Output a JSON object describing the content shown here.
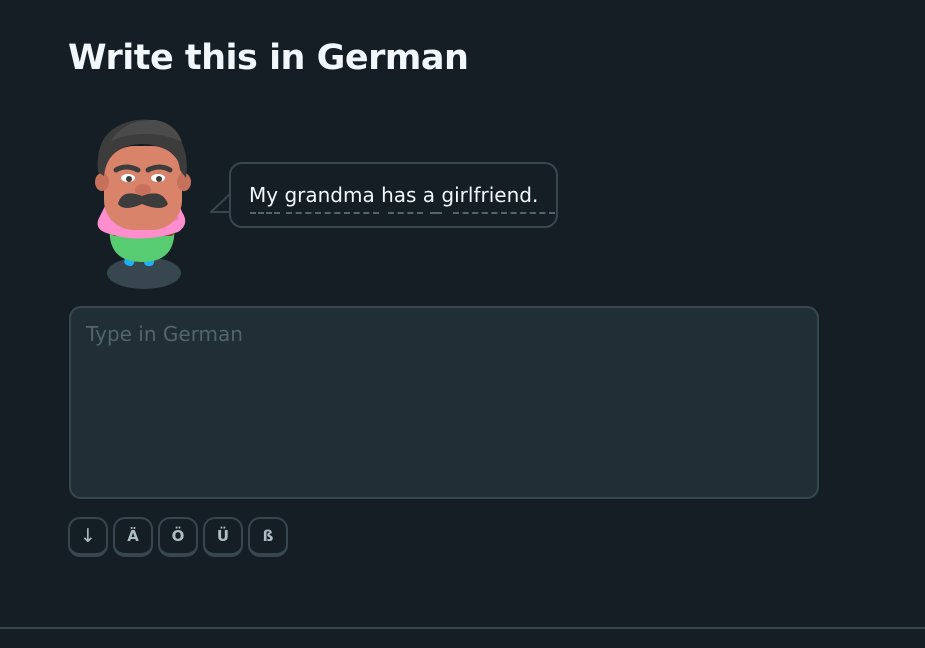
{
  "challenge": {
    "title": "Write this in German",
    "prompt_sentence": "My grandma has a girlfriend."
  },
  "answer": {
    "placeholder": "Type in German",
    "value": ""
  },
  "special_keys": [
    {
      "label": "↓",
      "name": "collapse-keys-button"
    },
    {
      "label": "Ä",
      "name": "key-a-umlaut"
    },
    {
      "label": "Ö",
      "name": "key-o-umlaut"
    },
    {
      "label": "Ü",
      "name": "key-u-umlaut"
    },
    {
      "label": "ß",
      "name": "key-eszett"
    }
  ],
  "colors": {
    "background": "#151e25",
    "text": "#f1f7fb",
    "border": "#37464f",
    "input_background": "#202f36",
    "placeholder": "#52656d"
  },
  "icons": {
    "character": "mustached-man-character-icon"
  }
}
